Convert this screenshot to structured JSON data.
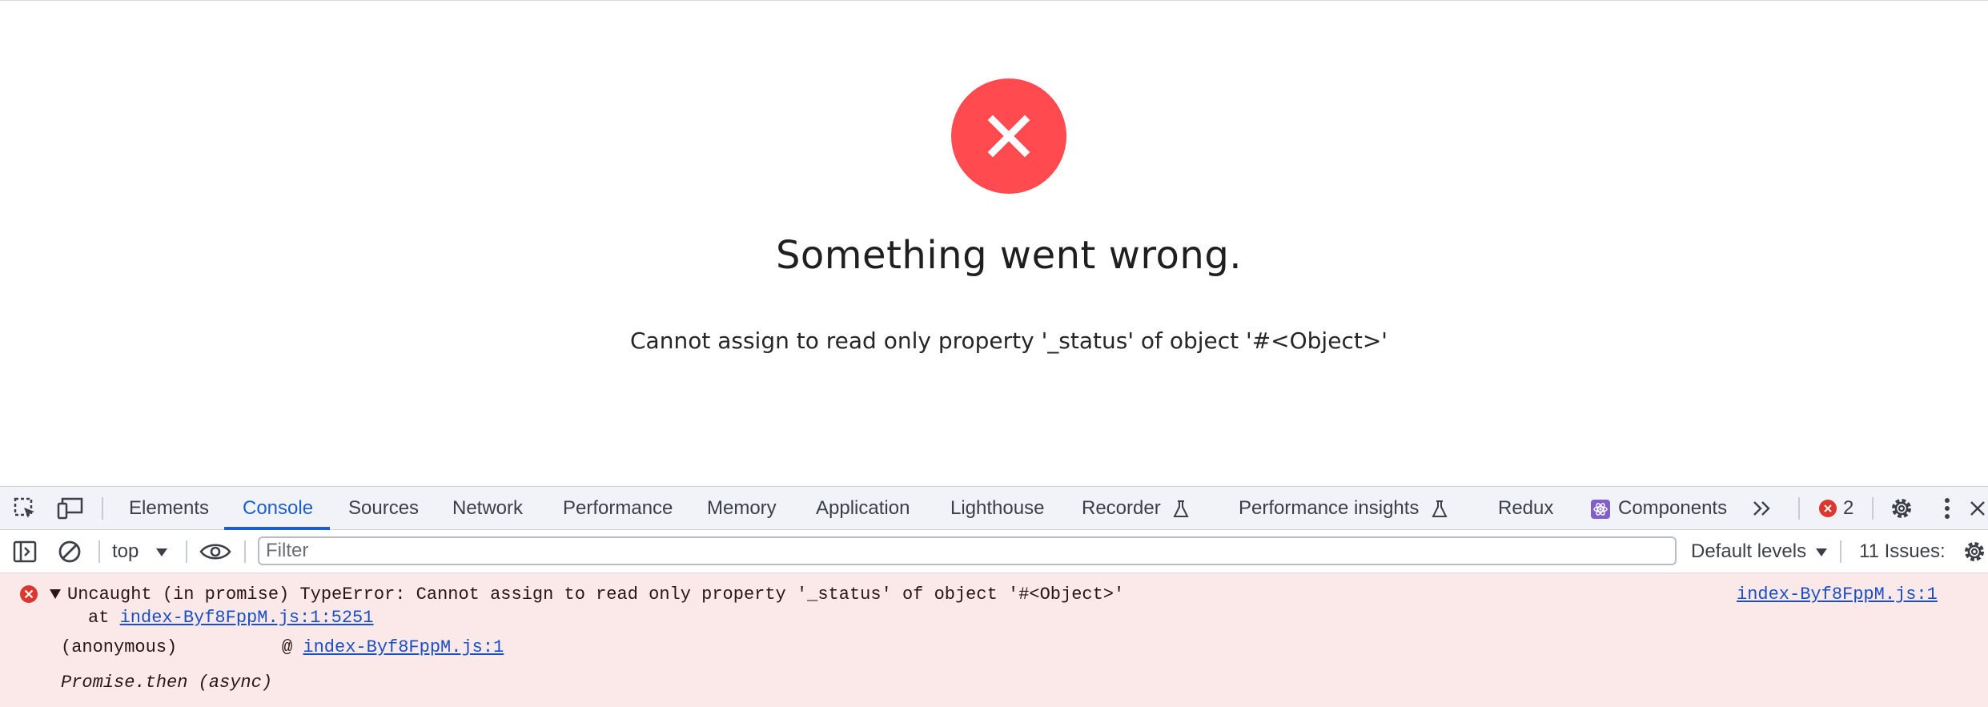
{
  "page": {
    "error_icon": "close-x-icon",
    "error_color": "#ff4a4f",
    "title": "Something went wrong.",
    "message": "Cannot assign to read only property '_status' of object '#<Object>'"
  },
  "devtools": {
    "tabs": [
      {
        "label": "Elements",
        "active": false
      },
      {
        "label": "Console",
        "active": true
      },
      {
        "label": "Sources",
        "active": false
      },
      {
        "label": "Network",
        "active": false
      },
      {
        "label": "Performance",
        "active": false
      },
      {
        "label": "Memory",
        "active": false
      },
      {
        "label": "Application",
        "active": false
      },
      {
        "label": "Lighthouse",
        "active": false
      },
      {
        "label": "Recorder",
        "active": false
      },
      {
        "label": "Performance insights",
        "active": false
      },
      {
        "label": "Redux",
        "active": false
      },
      {
        "label": "Components",
        "active": false
      }
    ],
    "more_tabs_icon": "chevron-double-right-icon",
    "error_count": "2",
    "accent_color": "#1a5fd0",
    "toolbar": {
      "context": "top",
      "filter_placeholder": "Filter",
      "levels": "Default levels",
      "issues": "11 Issues:"
    },
    "console": {
      "error_text": "Uncaught (in promise) TypeError: Cannot assign to read only property '_status' of object '#<Object>'",
      "source_link": "index-Byf8FppM.js:1",
      "stack_at": "at ",
      "stack_link": "index-Byf8FppM.js:1:5251",
      "frame_name": "(anonymous)",
      "frame_at": "@ ",
      "frame_link": "index-Byf8FppM.js:1",
      "async_label": "Promise.then (async)"
    }
  }
}
